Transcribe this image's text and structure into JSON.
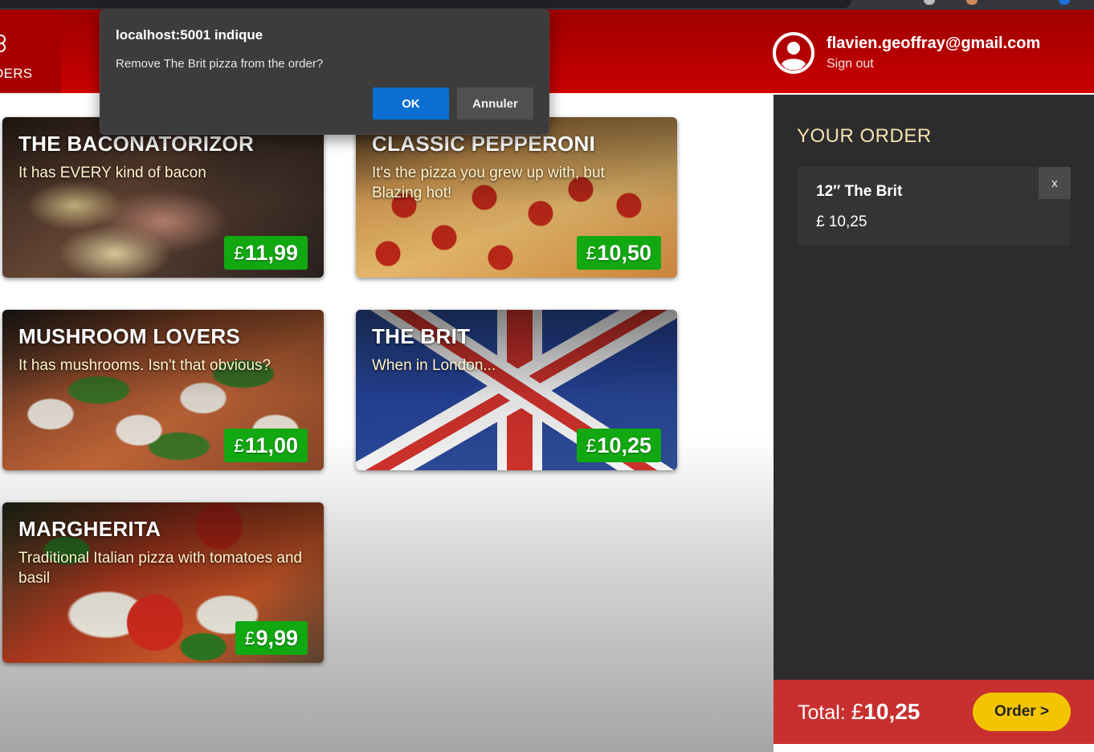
{
  "header": {
    "nav_label": "DERS",
    "user_email": "flavien.geoffray@gmail.com",
    "sign_out_label": "Sign out"
  },
  "specials": [
    {
      "name": "THE BACONATORIZOR",
      "description": "It has EVERY kind of bacon",
      "currency": "£",
      "price": "11,99"
    },
    {
      "name": "CLASSIC PEPPERONI",
      "description": "It's the pizza you grew up with, but Blazing hot!",
      "currency": "£",
      "price": "10,50"
    },
    {
      "name": "MUSHROOM LOVERS",
      "description": "It has mushrooms. Isn't that obvious?",
      "currency": "£",
      "price": "11,00"
    },
    {
      "name": "THE BRIT",
      "description": "When in London...",
      "currency": "£",
      "price": "10,25"
    },
    {
      "name": "MARGHERITA",
      "description": "Traditional Italian pizza with tomatoes and basil",
      "currency": "£",
      "price": "9,99"
    }
  ],
  "order": {
    "heading": "YOUR ORDER",
    "items": [
      {
        "name": "12″ The Brit",
        "price": "£ 10,25",
        "remove_label": "x"
      }
    ],
    "total_label": "Total:",
    "total_currency": "£",
    "total_amount": "10,25",
    "order_button_label": "Order >"
  },
  "dialog": {
    "origin": "localhost:5001 indique",
    "message": "Remove The Brit pizza from the order?",
    "ok_label": "OK",
    "cancel_label": "Annuler"
  },
  "colors": {
    "header_red": "#c80000",
    "price_green": "#12a812",
    "sidebar_dark": "#2c2c2c",
    "total_red": "#c8302f",
    "order_button_yellow": "#f5c400",
    "dialog_ok_blue": "#0a6fd0"
  }
}
